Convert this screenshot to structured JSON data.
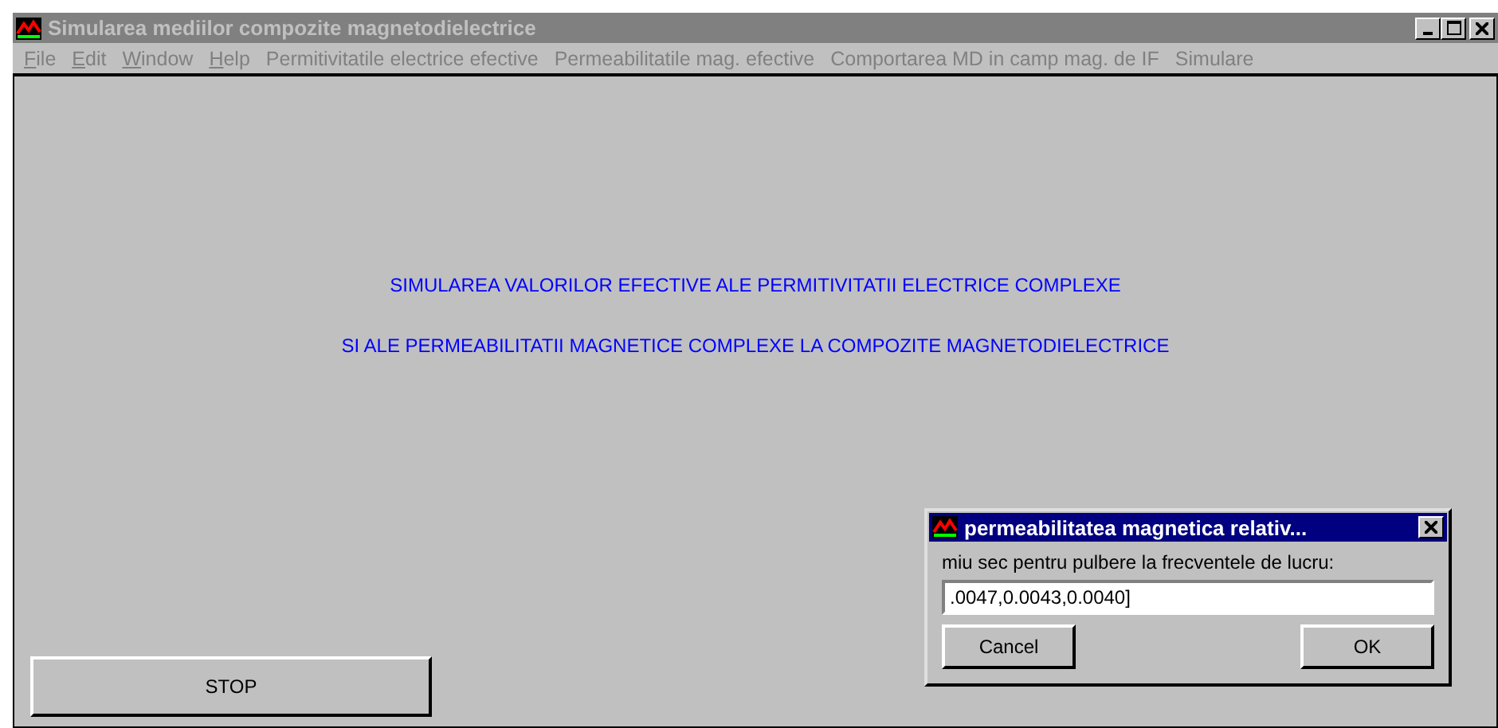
{
  "window": {
    "title": "Simularea mediilor compozite magnetodielectrice",
    "active": false
  },
  "menu": [
    {
      "label": "File",
      "underline_first": true,
      "disabled": true
    },
    {
      "label": "Edit",
      "underline_first": true,
      "disabled": true
    },
    {
      "label": "Window",
      "underline_first": true,
      "disabled": true
    },
    {
      "label": "Help",
      "underline_first": true,
      "disabled": true
    },
    {
      "label": "Permitivitatile electrice efective",
      "underline_first": false,
      "disabled": true
    },
    {
      "label": "Permeabilitatile mag. efective",
      "underline_first": false,
      "disabled": true
    },
    {
      "label": "Comportarea MD in camp mag. de IF",
      "underline_first": false,
      "disabled": true
    },
    {
      "label": "Simulare",
      "underline_first": false,
      "disabled": true
    }
  ],
  "heading_lines": [
    "SIMULAREA VALORILOR EFECTIVE ALE PERMITIVITATII ELECTRICE COMPLEXE",
    "SI ALE PERMEABILITATII MAGNETICE COMPLEXE LA COMPOZITE MAGNETODIELECTRICE"
  ],
  "stop_button": "STOP",
  "dialog": {
    "title": "permeabilitatea magnetica relativ...",
    "active": true,
    "prompt": "miu sec pentru pulbere la frecventele de lucru:",
    "value": ".0047,0.0043,0.0040]",
    "buttons": [
      "Cancel",
      "OK"
    ]
  }
}
